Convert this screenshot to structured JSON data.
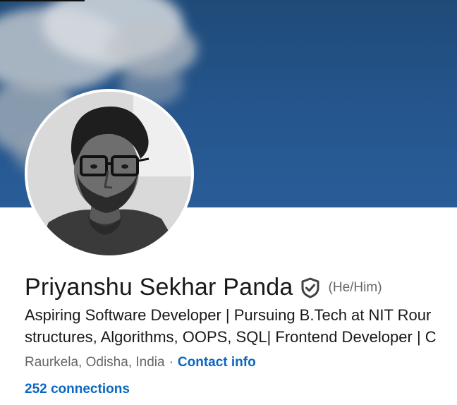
{
  "profile": {
    "name": "Priyanshu Sekhar Panda",
    "verified_icon": "shield-check-icon",
    "pronouns": "(He/Him)",
    "headline_line1": "Aspiring Software Developer | Pursuing B.Tech at NIT Rour",
    "headline_line2": "structures, Algorithms, OOPS, SQL| Frontend Developer | C",
    "location": "Raurkela, Odisha, India",
    "separator": "·",
    "contact_info_label": "Contact info",
    "connections_label": "252 connections"
  },
  "colors": {
    "link": "#0a66c2",
    "text_primary": "#191919",
    "text_secondary": "#666666",
    "cover_sky": "#24548a"
  }
}
